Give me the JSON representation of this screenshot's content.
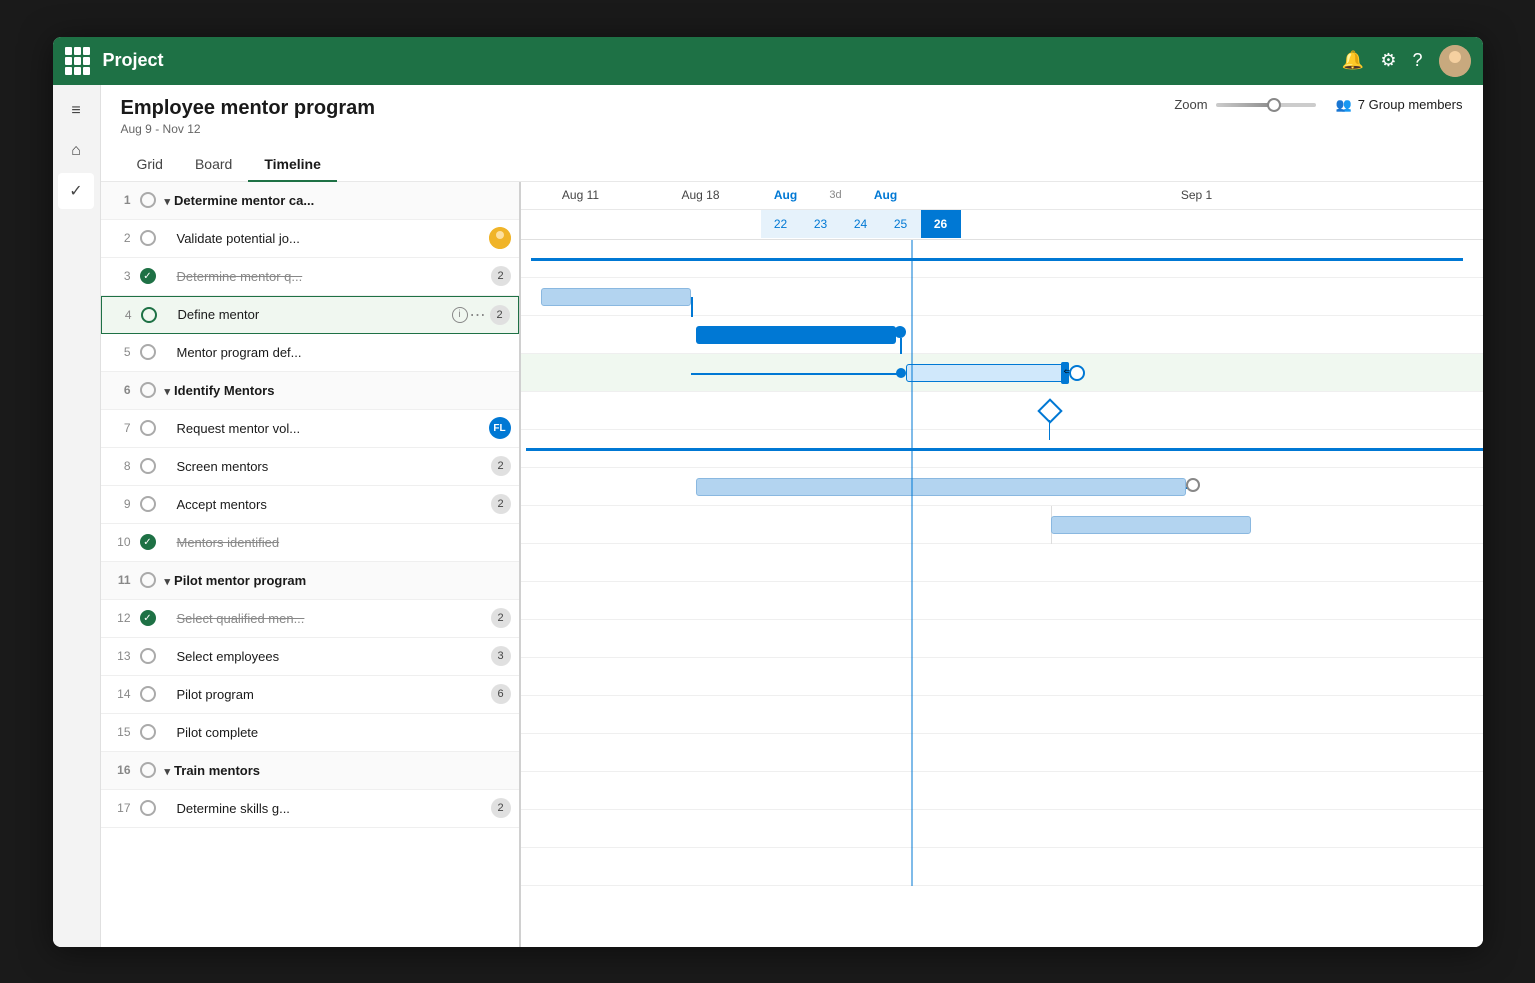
{
  "app": {
    "title": "Project",
    "accent_color": "#1e7145"
  },
  "header": {
    "project_title": "Employee mentor program",
    "project_dates": "Aug 9 - Nov 12",
    "zoom_label": "Zoom",
    "group_members": "7 Group members"
  },
  "tabs": [
    {
      "id": "grid",
      "label": "Grid",
      "active": false
    },
    {
      "id": "board",
      "label": "Board",
      "active": false
    },
    {
      "id": "timeline",
      "label": "Timeline",
      "active": true
    }
  ],
  "timeline": {
    "dates_top": [
      "Aug 11",
      "Aug 18",
      "Aug",
      "3d",
      "Aug",
      "Sep 1"
    ],
    "dates_bottom": [
      "22",
      "23",
      "24",
      "25",
      "26"
    ],
    "highlighted_date": "26"
  },
  "tasks": [
    {
      "num": 1,
      "status": "empty",
      "name": "Determine mentor ca...",
      "group": true,
      "badge": null,
      "indent": 0
    },
    {
      "num": 2,
      "status": "empty",
      "name": "Validate potential jo...",
      "badge": null,
      "avatar": "yellow",
      "indent": 1
    },
    {
      "num": 3,
      "status": "done",
      "name": "Determine mentor q...",
      "badge": "2",
      "strikethrough": true,
      "indent": 1
    },
    {
      "num": 4,
      "status": "empty",
      "name": "Define mentor",
      "badge": "2",
      "info": true,
      "more": true,
      "selected": true,
      "indent": 1
    },
    {
      "num": 5,
      "status": "empty",
      "name": "Mentor program def...",
      "badge": null,
      "indent": 1
    },
    {
      "num": 6,
      "status": "empty",
      "name": "Identify Mentors",
      "group": true,
      "badge": null,
      "indent": 0
    },
    {
      "num": 7,
      "status": "empty",
      "name": "Request mentor vol...",
      "badge": null,
      "avatar": "blue",
      "indent": 1
    },
    {
      "num": 8,
      "status": "empty",
      "name": "Screen mentors",
      "badge": "2",
      "indent": 1
    },
    {
      "num": 9,
      "status": "empty",
      "name": "Accept mentors",
      "badge": "2",
      "indent": 1
    },
    {
      "num": 10,
      "status": "done",
      "name": "Mentors identified",
      "badge": null,
      "strikethrough": true,
      "indent": 1
    },
    {
      "num": 11,
      "status": "empty",
      "name": "Pilot mentor program",
      "group": true,
      "badge": null,
      "indent": 0
    },
    {
      "num": 12,
      "status": "done",
      "name": "Select qualified men...",
      "badge": "2",
      "strikethrough": true,
      "indent": 1
    },
    {
      "num": 13,
      "status": "empty",
      "name": "Select employees",
      "badge": "3",
      "indent": 1
    },
    {
      "num": 14,
      "status": "empty",
      "name": "Pilot program",
      "badge": "6",
      "indent": 1
    },
    {
      "num": 15,
      "status": "empty",
      "name": "Pilot complete",
      "badge": null,
      "indent": 1
    },
    {
      "num": 16,
      "status": "empty",
      "name": "Train mentors",
      "group": true,
      "badge": null,
      "indent": 0
    },
    {
      "num": 17,
      "status": "empty",
      "name": "Determine skills g...",
      "badge": "2",
      "indent": 1
    }
  ]
}
